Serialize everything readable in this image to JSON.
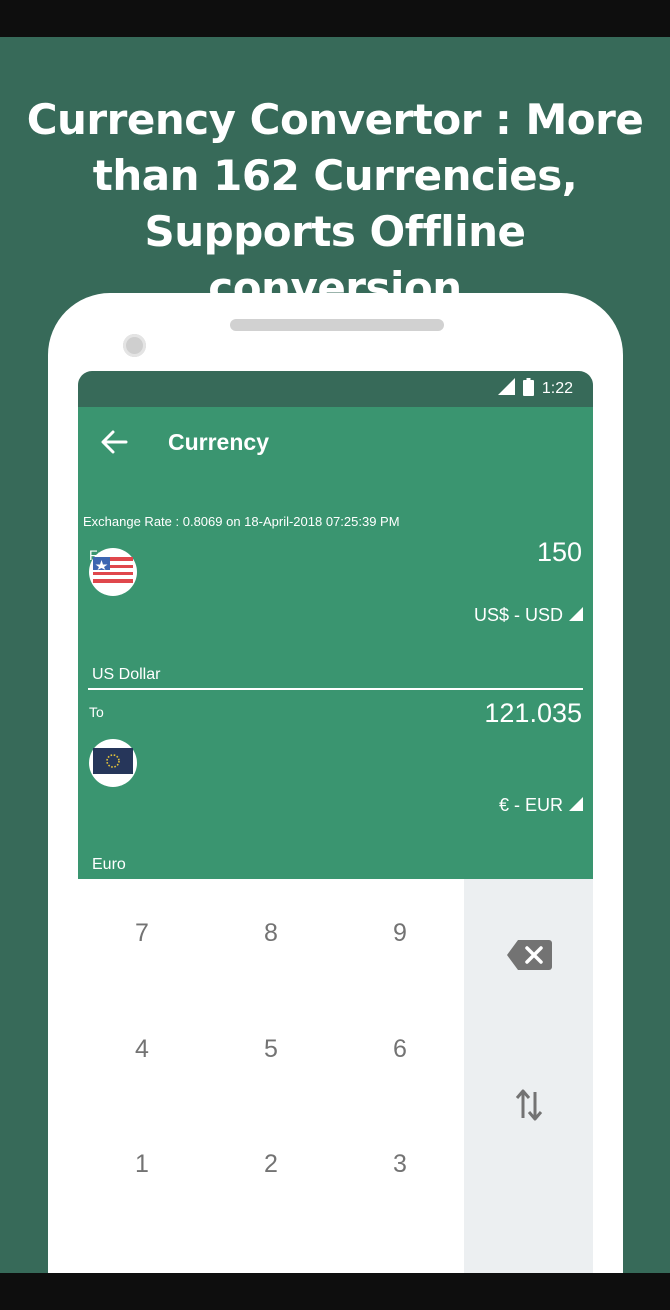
{
  "promo": {
    "headline_lines": [
      "Currency Convertor : More",
      "than 162 Currencies,",
      "Supports Offline conversion"
    ]
  },
  "status_bar": {
    "time": "1:22",
    "icons": [
      "signal-icon",
      "battery-icon"
    ]
  },
  "app_bar": {
    "title": "Currency",
    "back_icon": "arrow-left-icon"
  },
  "exchange_rate": "Exchange Rate : 0.8069 on 18-April-2018 07:25:39 PM",
  "from": {
    "label": "From",
    "amount": "150",
    "currency_select": "US$ - USD",
    "currency_name": "US Dollar",
    "flag": "us-flag-icon"
  },
  "to": {
    "label": "To",
    "amount": "121.035",
    "currency_select": "€ - EUR",
    "currency_name": "Euro",
    "flag": "eu-flag-icon"
  },
  "keypad": {
    "keys": [
      "7",
      "8",
      "9",
      "4",
      "5",
      "6",
      "1",
      "2",
      "3"
    ],
    "backspace_icon": "backspace-icon",
    "swap_icon": "swap-vertical-icon"
  },
  "colors": {
    "page_background": "#376a59",
    "app_bar": "#3a9570",
    "status_bar": "#376a59",
    "keypad_side_panel": "#eceff1",
    "key_text": "#737373"
  }
}
